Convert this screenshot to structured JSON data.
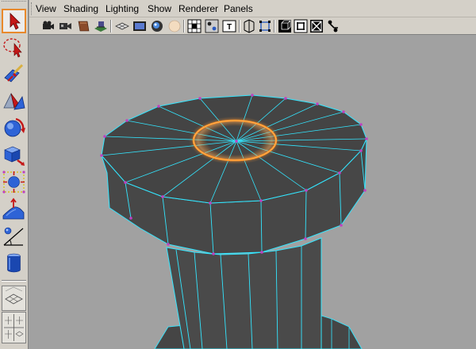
{
  "menu": {
    "items": [
      {
        "label": "View"
      },
      {
        "label": "Shading"
      },
      {
        "label": "Lighting"
      },
      {
        "label": "Show"
      },
      {
        "label": "Renderer"
      },
      {
        "label": "Panels"
      }
    ]
  },
  "toolbox": {
    "tools": [
      {
        "icon": "select-arrow-icon",
        "state": "selected"
      },
      {
        "icon": "lasso-select-icon"
      },
      {
        "icon": "paint-select-icon"
      },
      {
        "icon": "move-tool-icon"
      },
      {
        "icon": "rotate-tool-icon"
      },
      {
        "icon": "scale-tool-icon"
      },
      {
        "icon": "universal-manipulator-icon"
      },
      {
        "icon": "soft-modification-icon"
      },
      {
        "icon": "show-manipulator-icon"
      },
      {
        "icon": "last-tool-used-icon"
      }
    ],
    "layouts": [
      {
        "icon": "single-perspective-layout-icon"
      },
      {
        "icon": "four-view-layout-icon"
      }
    ]
  },
  "panel_toolbar": {
    "icons": [
      "select-camera-icon",
      "camera-attributes-icon",
      "bookmarks-icon",
      "image-plane-icon",
      "grid-icon",
      "film-gate-icon",
      "resolution-gate-icon",
      "xray-icon",
      "wireframe-icon",
      "smooth-shade-icon",
      "use-default-material-icon",
      "isolate-select-icon",
      "xray-joints-icon",
      "textured-icon",
      "high-quality-icon",
      "shadows-icon",
      "safe-frame-icon"
    ]
  },
  "colors": {
    "viewport_bg": "#a1a1a1",
    "mesh_face": "#444444",
    "wire_highlight": "#33e6ff",
    "vertex": "#c040c0",
    "manipulator": "#ff8c1a",
    "selection_border": "#e8892c"
  }
}
